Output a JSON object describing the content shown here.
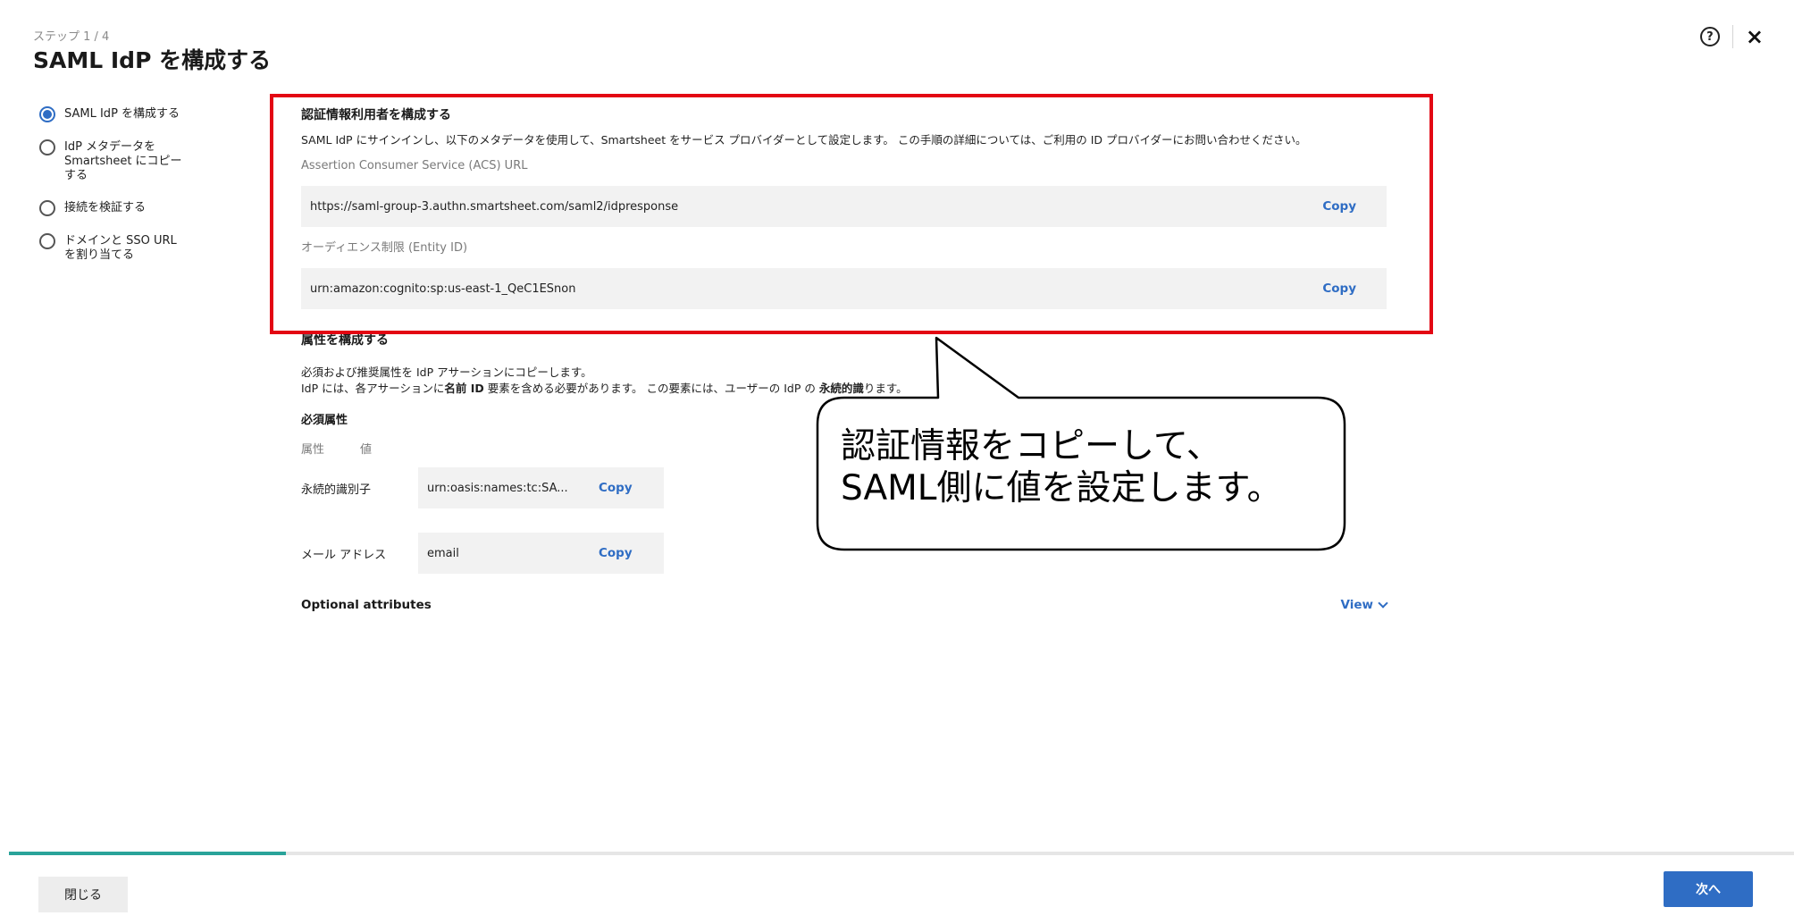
{
  "header": {
    "step": "ステップ 1 / 4",
    "title": "SAML IdP を構成する",
    "help_icon": "?",
    "close_icon": "×"
  },
  "stepper": {
    "items": [
      {
        "label": "SAML IdP を構成する",
        "active": true
      },
      {
        "label": "IdP メタデータを Smartsheet にコピーする",
        "active": false
      },
      {
        "label": "接続を検証する",
        "active": false
      },
      {
        "label": "ドメインと SSO URL を割り当てる",
        "active": false
      }
    ]
  },
  "credentials": {
    "title": "認証情報利用者を構成する",
    "description": "SAML IdP にサインインし、以下のメタデータを使用して、Smartsheet をサービス プロバイダーとして設定します。 この手順の詳細については、ご利用の ID プロバイダーにお問い合わせください。",
    "acs_label": "Assertion Consumer Service (ACS) URL",
    "acs_value": "https://saml-group-3.authn.smartsheet.com/saml2/idpresponse",
    "entity_label": "オーディエンス制限 (Entity ID)",
    "entity_value": "urn:amazon:cognito:sp:us-east-1_QeC1ESnon",
    "copy_label": "Copy"
  },
  "attributes": {
    "title": "属性を構成する",
    "desc_line1": "必須および推奨属性を IdP アサーションにコピーします。",
    "desc_line2_pre": "IdP には、各アサーションに",
    "desc_line2_bold": "名前 ID",
    "desc_line2_mid": "要素を含める必要があります。 この要素には、ユーザーの IdP の",
    "desc_line2_bold2": "永続的識",
    "desc_line2_post": "ります。",
    "required_title": "必須属性",
    "col_attr": "属性",
    "col_value": "値",
    "rows": [
      {
        "name": "永続的識別子",
        "value": "urn:oasis:names:tc:SA..."
      },
      {
        "name": "メール アドレス",
        "value": "email"
      }
    ],
    "copy_label": "Copy",
    "optional_title": "Optional attributes",
    "view_label": "View"
  },
  "callout": {
    "line1": "認証情報をコピーして、",
    "line2": "SAML側に値を設定します。"
  },
  "footer": {
    "progress": 0.155,
    "close_label": "閉じる",
    "next_label": "次へ",
    "progress_color": "#2aa39a",
    "accent_color": "#2f6dc4",
    "highlight_color": "#e30613"
  }
}
